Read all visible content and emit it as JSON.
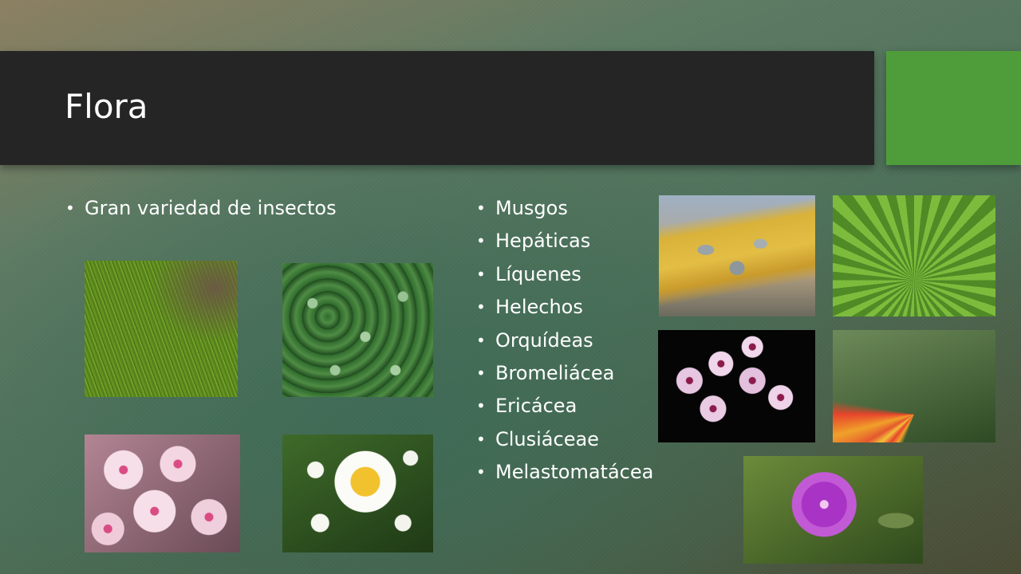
{
  "slide": {
    "title": "Flora",
    "colors": {
      "title_bar": "#252525",
      "accent": "#4f9d3a",
      "text": "#ffffff"
    },
    "left_bullets": [
      "Gran variedad de insectos"
    ],
    "right_bullets": [
      "Musgos",
      "Hepáticas",
      "Líquenes",
      "Helechos",
      "Orquídeas",
      "Bromeliácea",
      "Ericácea",
      "Clusiáceae",
      "Melastomatácea"
    ]
  }
}
